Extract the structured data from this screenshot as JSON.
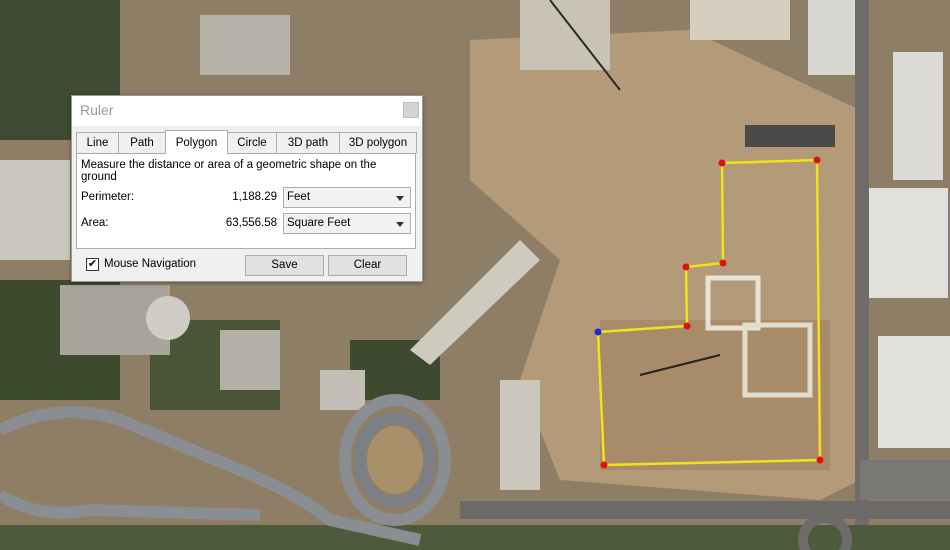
{
  "ruler": {
    "title": "Ruler",
    "tabs": [
      {
        "label": "Line"
      },
      {
        "label": "Path"
      },
      {
        "label": "Polygon"
      },
      {
        "label": "Circle"
      },
      {
        "label": "3D path"
      },
      {
        "label": "3D polygon"
      }
    ],
    "active_tab": "Polygon",
    "description": "Measure the distance or area of a geometric shape on the ground",
    "perimeter": {
      "label": "Perimeter:",
      "value": "1,188.29",
      "unit": "Feet"
    },
    "area": {
      "label": "Area:",
      "value": "63,556.58",
      "unit": "Square Feet"
    },
    "mouse_navigation": {
      "label": "Mouse Navigation",
      "checked": true
    },
    "save_label": "Save",
    "clear_label": "Clear"
  },
  "colors": {
    "polygon_line": "#f2e21a",
    "vertex": "#e01010",
    "start_vertex": "#1a2bd6",
    "dialog_bg": "#f0f0f0"
  }
}
